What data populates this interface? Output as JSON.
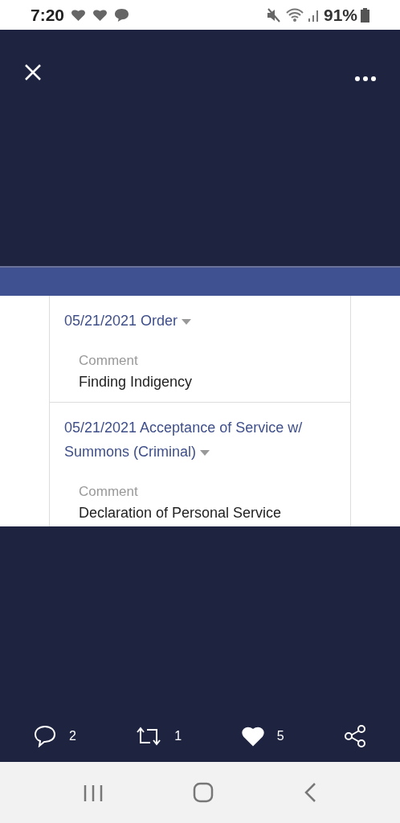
{
  "status_bar": {
    "time": "7:20",
    "battery": "91%"
  },
  "entries": [
    {
      "title": "05/21/2021 Order",
      "comment_label": "Comment",
      "comment": "Finding Indigency"
    },
    {
      "title": "05/21/2021 Acceptance of Service w/ Summons (Criminal)",
      "comment_label": "Comment",
      "comment": "Declaration of Personal Service"
    }
  ],
  "actions": {
    "replies": "2",
    "retweets": "1",
    "likes": "5",
    "liked": true
  }
}
